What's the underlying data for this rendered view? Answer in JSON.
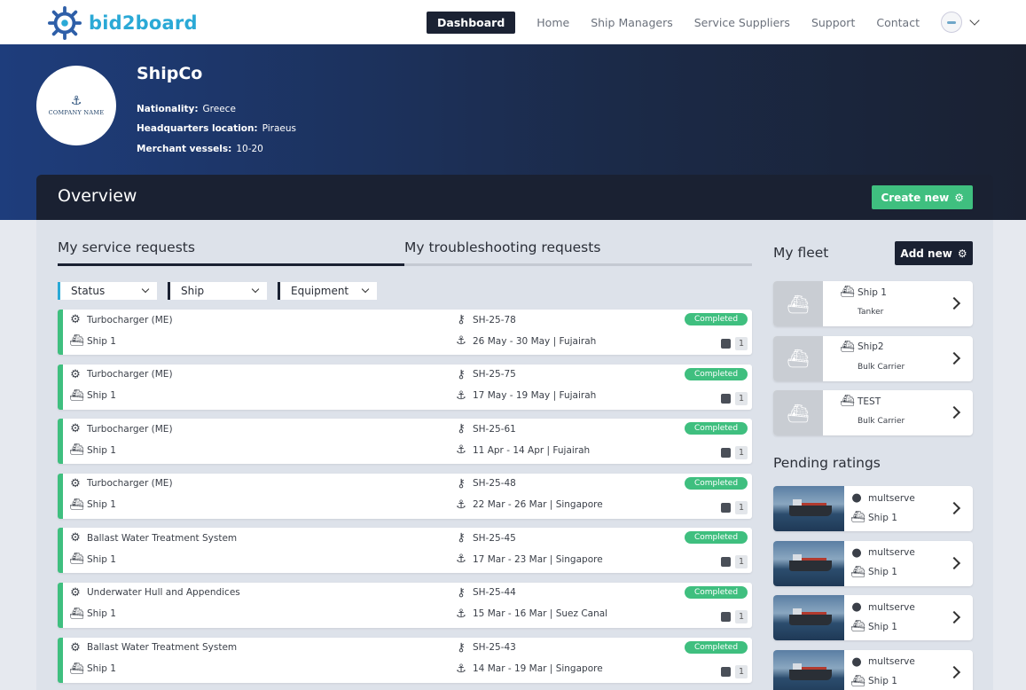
{
  "brand": {
    "name": "bid2board",
    "accent": "#2aa9d6"
  },
  "nav": {
    "items": [
      {
        "label": "Dashboard",
        "active": true
      },
      {
        "label": "Home"
      },
      {
        "label": "Ship Managers"
      },
      {
        "label": "Service Suppliers"
      },
      {
        "label": "Support"
      },
      {
        "label": "Contact"
      }
    ]
  },
  "company": {
    "logo_text": "COMPANY NAME",
    "name": "ShipCo",
    "nationality_label": "Nationality:",
    "nationality": "Greece",
    "hq_label": "Headquarters location:",
    "hq": "Piraeus",
    "vessels_label": "Merchant vessels:",
    "vessels": "10-20"
  },
  "overview": {
    "title": "Overview",
    "create_label": "Create new"
  },
  "tabs": [
    {
      "label": "My service requests",
      "active": true
    },
    {
      "label": "My troubleshooting requests",
      "active": false
    }
  ],
  "filters": [
    "Status",
    "Ship",
    "Equipment"
  ],
  "requests": [
    {
      "equipment": "Turbocharger (ME)",
      "ship": "Ship 1",
      "ref": "SH-25-78",
      "dates": "26 May - 30 May | Fujairah",
      "status": "Completed",
      "count": "1"
    },
    {
      "equipment": "Turbocharger (ME)",
      "ship": "Ship 1",
      "ref": "SH-25-75",
      "dates": "17 May - 19 May | Fujairah",
      "status": "Completed",
      "count": "1"
    },
    {
      "equipment": "Turbocharger (ME)",
      "ship": "Ship 1",
      "ref": "SH-25-61",
      "dates": "11 Apr - 14 Apr | Fujairah",
      "status": "Completed",
      "count": "1"
    },
    {
      "equipment": "Turbocharger (ME)",
      "ship": "Ship 1",
      "ref": "SH-25-48",
      "dates": "22 Mar - 26 Mar | Singapore",
      "status": "Completed",
      "count": "1"
    },
    {
      "equipment": "Ballast Water Treatment System",
      "ship": "Ship 1",
      "ref": "SH-25-45",
      "dates": "17 Mar - 23 Mar | Singapore",
      "status": "Completed",
      "count": "1"
    },
    {
      "equipment": "Underwater Hull and Appendices",
      "ship": "Ship 1",
      "ref": "SH-25-44",
      "dates": "15 Mar - 16 Mar | Suez Canal",
      "status": "Completed",
      "count": "1"
    },
    {
      "equipment": "Ballast Water Treatment System",
      "ship": "Ship 1",
      "ref": "SH-25-43",
      "dates": "14 Mar - 19 Mar | Singapore",
      "status": "Completed",
      "count": "1"
    }
  ],
  "fleet": {
    "title": "My fleet",
    "add_label": "Add new",
    "ships": [
      {
        "name": "Ship 1",
        "type": "Tanker"
      },
      {
        "name": "Ship2",
        "type": "Bulk Carrier"
      },
      {
        "name": "TEST",
        "type": "Bulk Carrier"
      }
    ]
  },
  "pending": {
    "title": "Pending ratings",
    "items": [
      {
        "user": "multserve",
        "ship": "Ship 1"
      },
      {
        "user": "multserve",
        "ship": "Ship 1"
      },
      {
        "user": "multserve",
        "ship": "Ship 1"
      },
      {
        "user": "multserve",
        "ship": "Ship 1"
      }
    ]
  },
  "colors": {
    "completed": "#3fbf7f",
    "dark": "#1a2132"
  }
}
